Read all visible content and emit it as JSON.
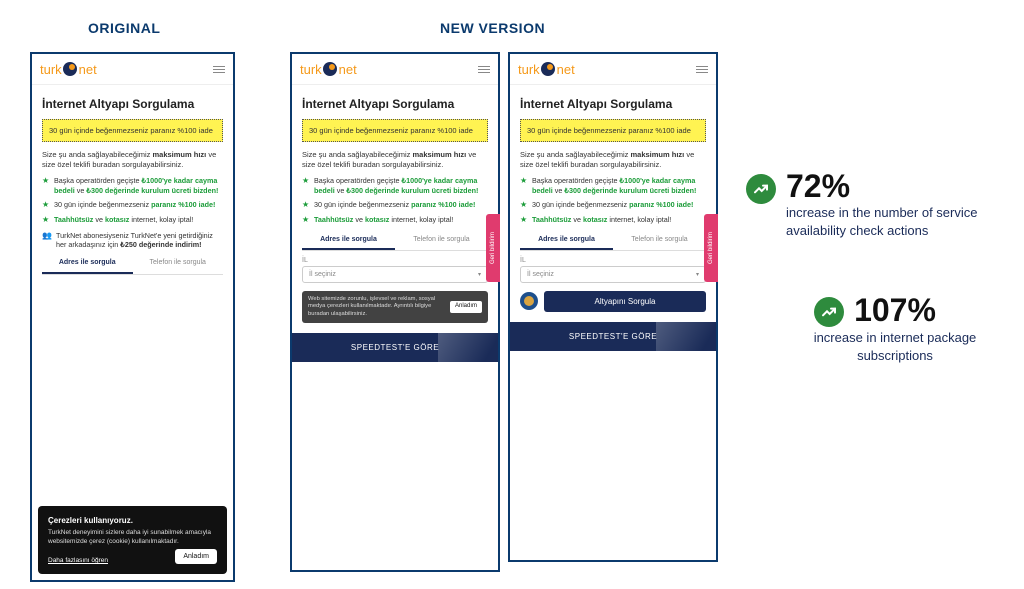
{
  "labels": {
    "original": "ORIGINAL",
    "new": "NEW VERSION"
  },
  "logo": {
    "a": "turk",
    "b": "net"
  },
  "heading": "İnternet Altyapı Sorgulama",
  "yellow": "30 gün içinde beğenmezseniz paranız %100 iade",
  "intro": {
    "a": "Size şu anda sağlayabileceğimiz ",
    "b": "maksimum hızı",
    "c": " ve size özel teklifi buradan sorgulayabilirsiniz."
  },
  "bullets": {
    "b1": {
      "a": "Başka operatörden geçişte ",
      "g1": "₺1000'ye kadar cayma bedeli",
      "b": " ve ",
      "g2": "₺300 değerinde kurulum ücreti bizden!"
    },
    "b2": {
      "a": "30 gün içinde beğenmezseniz ",
      "g": "paranız %100 iade!"
    },
    "b3": {
      "g1": "Taahhütsüz",
      "a": " ve ",
      "g2": "kotasız",
      "b": " internet, kolay iptal!"
    },
    "b4": {
      "a": "TurkNet abonesiyseniz TurkNet'e yeni getirdiğiniz her arkadaşınız için ",
      "g": "₺250 değerinde indirim!"
    }
  },
  "tabs": {
    "active": "Adres ile sorgula",
    "other": "Telefon ile sorgula"
  },
  "cookies": {
    "title": "Çerezleri kullanıyoruz.",
    "body": "TurkNet deneyimini sizlere daha iyi sunabilmek amacıyla websitemizde çerez (cookie) kullanılmaktadır.",
    "more": "Daha fazlasını öğren",
    "btn": "Anladım"
  },
  "field": {
    "label": "İL",
    "placeholder": "İl seçiniz"
  },
  "miniCookie": {
    "text": "Web sitemizde zorunlu, işlevsel ve reklam, sosyal medya çerezleri kullanılmaktadır. Ayrıntılı bilgiye buradan ulaşabilirsiniz.",
    "btn": "Anladım"
  },
  "speedtest": "SPEEDTEST'E GÖRE",
  "cta": "Altyapını Sorgula",
  "geri": "Geri bildirim",
  "stats": {
    "s1": {
      "pct": "72%",
      "txt": "increase in the number of service availability check actions"
    },
    "s2": {
      "pct": "107%",
      "txt": "increase in internet package subscriptions"
    }
  }
}
